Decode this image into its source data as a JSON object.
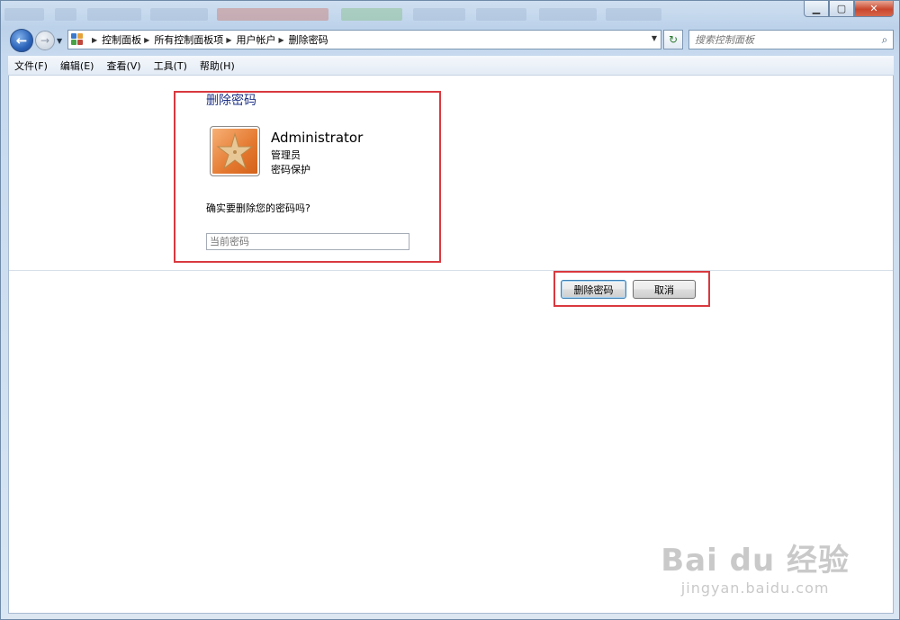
{
  "window": {
    "minimize_glyph": "▁",
    "maximize_glyph": "▢",
    "close_glyph": "✕"
  },
  "nav": {
    "back_glyph": "←",
    "forward_glyph": "→",
    "breadcrumbs": [
      "控制面板",
      "所有控制面板项",
      "用户帐户",
      "删除密码"
    ],
    "search_placeholder": "搜索控制面板",
    "refresh_glyph": "↻",
    "search_glyph": "⌕"
  },
  "menu": {
    "items": [
      "文件(F)",
      "编辑(E)",
      "查看(V)",
      "工具(T)",
      "帮助(H)"
    ]
  },
  "page": {
    "title": "删除密码",
    "user_name": "Administrator",
    "user_role": "管理员",
    "user_status": "密码保护",
    "question": "确实要删除您的密码吗?",
    "password_placeholder": "当前密码",
    "delete_button": "删除密码",
    "cancel_button": "取消"
  },
  "watermark": {
    "main": "Bai du 经验",
    "sub": "jingyan.baidu.com"
  },
  "colors": {
    "highlight": "#d9393f",
    "title_blue": "#1e3287"
  }
}
